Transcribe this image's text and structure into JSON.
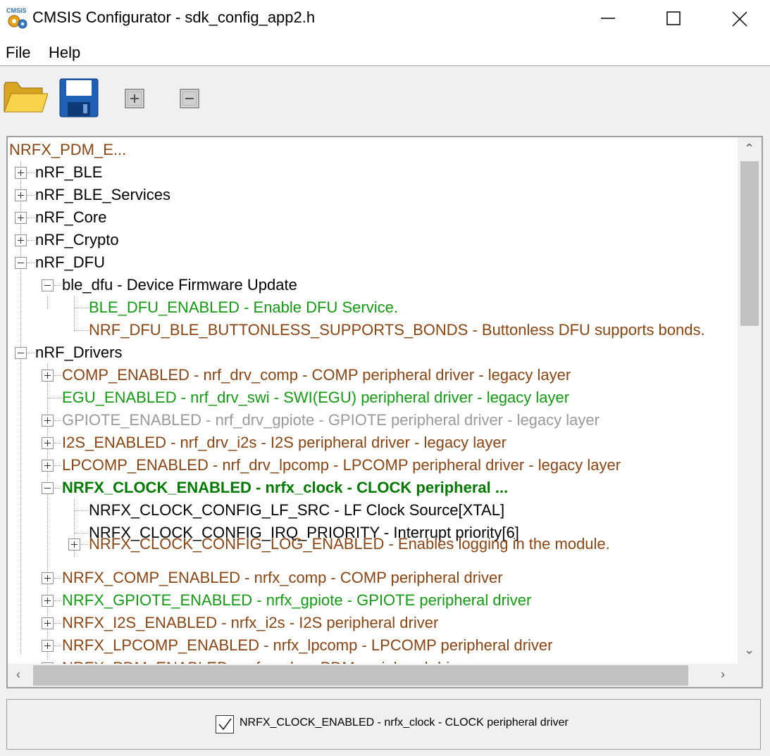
{
  "window": {
    "title": "CMSIS Configurator - sdk_config_app2.h",
    "app_icon_text": "CMSIS"
  },
  "menu": {
    "file": "File",
    "help": "Help"
  },
  "tree": {
    "header": "NRFX_PDM_E...",
    "nodes": [
      {
        "label": "nRF_BLE"
      },
      {
        "label": "nRF_BLE_Services"
      },
      {
        "label": "nRF_Core"
      },
      {
        "label": "nRF_Crypto"
      },
      {
        "label": "nRF_DFU"
      },
      {
        "label": "ble_dfu - Device Firmware Update"
      },
      {
        "label": "BLE_DFU_ENABLED  - Enable DFU Service."
      },
      {
        "label": "NRF_DFU_BLE_BUTTONLESS_SUPPORTS_BONDS  - Buttonless DFU supports bonds."
      },
      {
        "label": "nRF_Drivers"
      },
      {
        "label": "COMP_ENABLED - nrf_drv_comp - COMP peripheral driver - legacy layer"
      },
      {
        "label": "EGU_ENABLED  - nrf_drv_swi - SWI(EGU) peripheral driver - legacy layer"
      },
      {
        "label": "GPIOTE_ENABLED - nrf_drv_gpiote - GPIOTE peripheral driver - legacy layer"
      },
      {
        "label": "I2S_ENABLED - nrf_drv_i2s - I2S peripheral driver - legacy layer"
      },
      {
        "label": "LPCOMP_ENABLED - nrf_drv_lpcomp - LPCOMP peripheral driver - legacy layer"
      },
      {
        "label": "NRFX_CLOCK_ENABLED - nrfx_clock - CLOCK peripheral ..."
      },
      {
        "label": "NRFX_CLOCK_CONFIG_LF_SRC  - LF Clock Source[XTAL]"
      },
      {
        "label": "NRFX_CLOCK_CONFIG_IRQ_PRIORITY  - Interrupt priority[6]"
      },
      {
        "label": "NRFX_CLOCK_CONFIG_LOG_ENABLED - Enables logging in the module."
      },
      {
        "label": "NRFX_COMP_ENABLED - nrfx_comp - COMP peripheral driver"
      },
      {
        "label": "NRFX_GPIOTE_ENABLED - nrfx_gpiote - GPIOTE peripheral driver"
      },
      {
        "label": "NRFX_I2S_ENABLED - nrfx_i2s - I2S peripheral driver"
      },
      {
        "label": "NRFX_LPCOMP_ENABLED - nrfx_lpcomp - LPCOMP peripheral driver"
      },
      {
        "label": "NRFX_PDM_ENABLED - nrfx_pdm - PDM peripheral driver"
      }
    ]
  },
  "status": {
    "checked": true,
    "text": "NRFX_CLOCK_ENABLED - nrfx_clock - CLOCK peripheral driver"
  },
  "colors": {
    "enabled": "#149b14",
    "disabled_option": "#8b4513",
    "inactive": "#9a9a9a",
    "selected": "#007a00"
  }
}
